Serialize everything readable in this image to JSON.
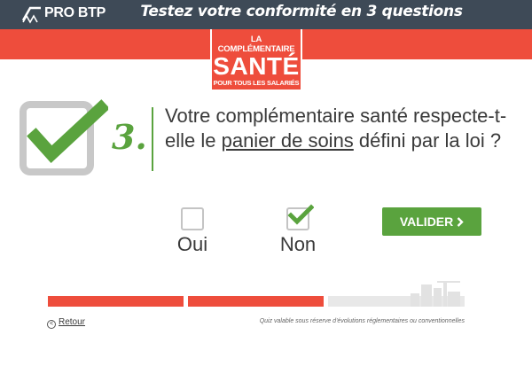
{
  "header": {
    "logo_text": "PRO BTP",
    "title": "Testez votre conformité en 3 questions"
  },
  "badge": {
    "line1": "LA COMPLÉMENTAIRE",
    "line2": "SANTÉ",
    "line3": "POUR TOUS LES SALARIÉS"
  },
  "question": {
    "number": "3.",
    "text_before": "Votre complémentaire santé respecte-t-elle le ",
    "text_link": "panier de soins",
    "text_after": " défini par la loi ?"
  },
  "answers": [
    {
      "label": "Oui",
      "checked": false
    },
    {
      "label": "Non",
      "checked": true
    }
  ],
  "submit_label": "VALIDER",
  "progress": {
    "step": 3,
    "total": 3,
    "completed": 2
  },
  "footer": {
    "back_label": "Retour",
    "disclaimer": "Quiz valable sous réserve d'évolutions réglementaires ou conventionnelles"
  },
  "colors": {
    "accent_red": "#ee4d3c",
    "accent_green": "#5aa33e",
    "topbar": "#3e4a57",
    "progress_pending": "#e8e8e8"
  },
  "icons": [
    "probtp-logo-icon",
    "large-checkmark-icon",
    "checkbox-icon",
    "chevron-right-icon",
    "back-arrow-icon",
    "city-skyline-icon"
  ]
}
